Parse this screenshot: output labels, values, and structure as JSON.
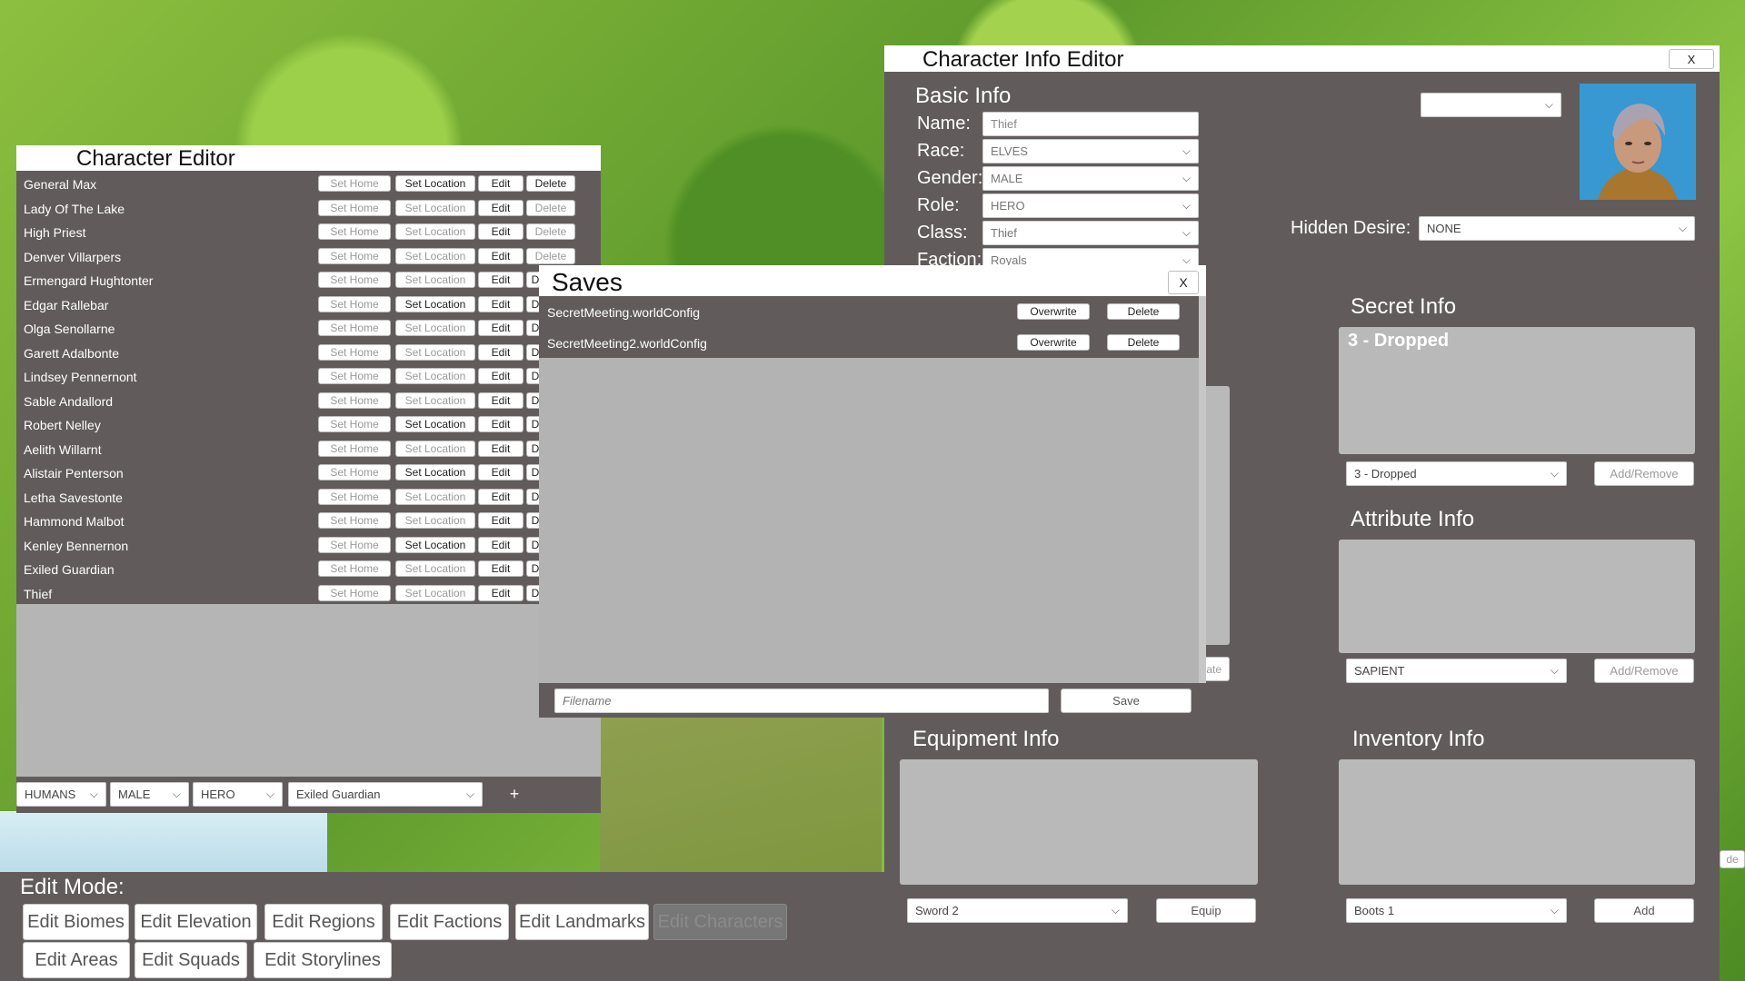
{
  "character_editor": {
    "title": "Character Editor",
    "btn_set_home": "Set Home",
    "btn_set_location": "Set Location",
    "btn_edit": "Edit",
    "btn_delete": "Delete",
    "btn_delete_short": "D",
    "characters": [
      {
        "name": "General Max",
        "loc_active": true
      },
      {
        "name": "Lady Of The Lake",
        "loc_active": false
      },
      {
        "name": "High Priest",
        "loc_active": false
      },
      {
        "name": "Denver Villarpers",
        "loc_active": false
      },
      {
        "name": "Ermengard Hughtonter",
        "loc_active": false
      },
      {
        "name": "Edgar Rallebar",
        "loc_active": true
      },
      {
        "name": "Olga Senollarne",
        "loc_active": false
      },
      {
        "name": "Garett Adalbonte",
        "loc_active": false
      },
      {
        "name": "Lindsey Pennernont",
        "loc_active": false
      },
      {
        "name": "Sable Andallord",
        "loc_active": false
      },
      {
        "name": "Robert Nelley",
        "loc_active": true
      },
      {
        "name": "Aelith Willarnt",
        "loc_active": false
      },
      {
        "name": "Alistair Penterson",
        "loc_active": true
      },
      {
        "name": "Letha Savestonte",
        "loc_active": false
      },
      {
        "name": "Hammond Malbot",
        "loc_active": false
      },
      {
        "name": "Kenley Bennernon",
        "loc_active": true
      },
      {
        "name": "Exiled Guardian",
        "loc_active": false
      },
      {
        "name": "Thief",
        "loc_active": false
      }
    ],
    "footer": {
      "race": "HUMANS",
      "gender": "MALE",
      "role": "HERO",
      "character": "Exiled Guardian",
      "add_label": "+"
    }
  },
  "saves": {
    "title": "Saves",
    "close_label": "X",
    "overwrite_label": "Overwrite",
    "delete_label": "Delete",
    "files": [
      "SecretMeeting.worldConfig",
      "SecretMeeting2.worldConfig"
    ],
    "filename_placeholder": "Filename",
    "save_label": "Save"
  },
  "info_editor": {
    "title": "Character Info Editor",
    "close_label": "X",
    "basic_info": {
      "heading": "Basic Info",
      "name_label": "Name:",
      "name_value": "Thief",
      "race_label": "Race:",
      "race_value": "ELVES",
      "gender_label": "Gender:",
      "gender_value": "MALE",
      "role_label": "Role:",
      "role_value": "HERO",
      "class_label": "Class:",
      "class_value": "Thief",
      "faction_label": "Faction:",
      "faction_value": "Royals"
    },
    "hidden_desire_label": "Hidden Desire:",
    "hidden_desire_value": "NONE",
    "portrait_select_value": "",
    "secret_info": {
      "heading": "Secret Info",
      "list_item": "3 - Dropped",
      "select_value": "3 - Dropped",
      "button": "Add/Remove"
    },
    "attribute_info": {
      "heading": "Attribute Info",
      "select_value": "SAPIENT",
      "button": "Add/Remove"
    },
    "equipment_info": {
      "heading": "Equipment Info",
      "select_value": "Sword 2",
      "button": "Equip"
    },
    "inventory_info": {
      "heading": "Inventory Info",
      "select_value": "Boots 1",
      "button": "Add"
    },
    "hidden_button_fragment": "ate",
    "edge_fragment": "de"
  },
  "edit_mode": {
    "label": "Edit Mode:",
    "buttons": [
      {
        "label": "Edit Biomes",
        "active": false
      },
      {
        "label": "Edit Elevation",
        "active": false
      },
      {
        "label": "Edit Regions",
        "active": false
      },
      {
        "label": "Edit Factions",
        "active": false
      },
      {
        "label": "Edit Landmarks",
        "active": false
      },
      {
        "label": "Edit Characters",
        "active": true
      },
      {
        "label": "Edit Areas",
        "active": false
      },
      {
        "label": "Edit Squads",
        "active": false
      },
      {
        "label": "Edit Storylines",
        "active": false
      }
    ]
  },
  "colors": {
    "panel": "#615c5b",
    "titlebar": "#ffffff",
    "content_box": "#b9b9b9"
  }
}
